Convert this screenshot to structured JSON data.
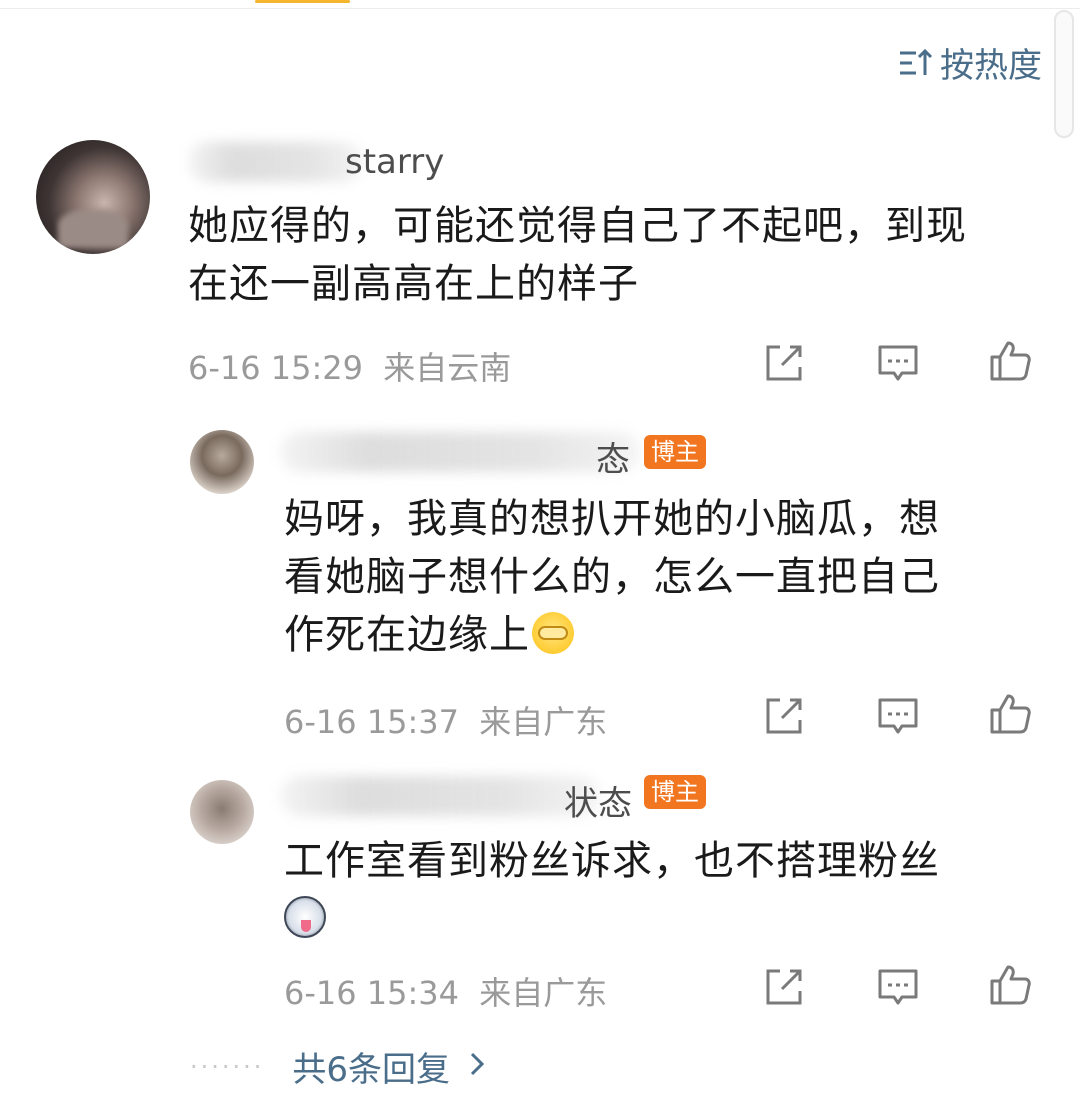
{
  "sort": {
    "label": "按热度",
    "icon": "sort-icon"
  },
  "comment": {
    "username_visible": "starry",
    "text_line1": "她应得的，可能还觉得自己了不起吧，到现",
    "text_line2": "在还一副高高在上的样子",
    "time": "6-16 15:29",
    "location": "来自云南"
  },
  "replies": [
    {
      "username_visible": "态",
      "badge": "博主",
      "text_line1": "妈呀，我真的想扒开她的小脑瓜，想",
      "text_line2": "看她脑子想什么的，怎么一直把自己",
      "text_line3": "作死在边缘上",
      "emoji": "cover-face-emoji",
      "time": "6-16 15:37",
      "location": "来自广东"
    },
    {
      "username_visible": "状态",
      "badge": "博主",
      "text_line1": "工作室看到粉丝诉求，也不搭理粉丝",
      "emoji": "husky-emoji",
      "time": "6-16 15:34",
      "location": "来自广东"
    }
  ],
  "more_replies": {
    "label": "共6条回复",
    "icon": "chevron-right-icon"
  },
  "colors": {
    "link": "#4a6d8a",
    "badge": "#f2751f",
    "meta": "#9a9a9a",
    "text": "#1a1a1a"
  }
}
